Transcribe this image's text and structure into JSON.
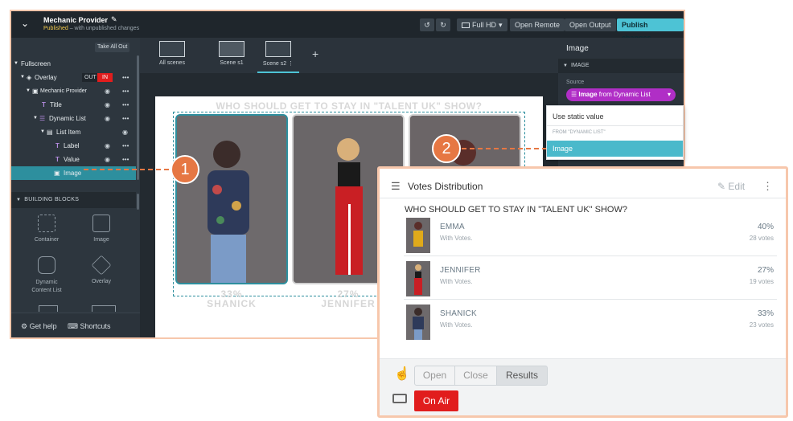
{
  "app": {
    "project_title": "Mechanic Provider",
    "status_published": "Published",
    "status_note": " – with unpublished changes",
    "toolbar": {
      "resolution": "Full HD",
      "open_remote": "Open Remote",
      "open_output": "Open Output",
      "publish": "Publish changes"
    },
    "tree": {
      "take_all_out": "Take All Out",
      "items": [
        {
          "label": "Fullscreen"
        },
        {
          "label": "Overlay",
          "out": "OUT",
          "in": "IN"
        },
        {
          "label": "Mechanic Provider"
        },
        {
          "label": "Title"
        },
        {
          "label": "Dynamic List"
        },
        {
          "label": "List Item"
        },
        {
          "label": "Label"
        },
        {
          "label": "Value"
        },
        {
          "label": "Image"
        }
      ]
    },
    "building_blocks": {
      "header": "BUILDING BLOCKS",
      "items": [
        {
          "label": "Container"
        },
        {
          "label": "Image"
        },
        {
          "label": "Dynamic Content List"
        },
        {
          "label": "Overlay"
        }
      ]
    },
    "footer": {
      "help": "Get help",
      "shortcuts": "Shortcuts"
    },
    "scenes": [
      {
        "label": "All scenes"
      },
      {
        "label": "Scene s1"
      },
      {
        "label": "Scene s2"
      }
    ],
    "canvas": {
      "title": "WHO SHOULD GET TO STAY IN \"TALENT UK\" SHOW?",
      "items": [
        {
          "pct": "33%",
          "name": "SHANICK"
        },
        {
          "pct": "27%",
          "name": "JENNIFER"
        }
      ]
    },
    "right_panel": {
      "title": "Image",
      "section": "IMAGE",
      "source_label": "Source",
      "source_value": "Image",
      "source_suffix": " from Dynamic List"
    },
    "dropdown": {
      "static": "Use static value",
      "group": "FROM \"DYNAMIC LIST\"",
      "option": "Image"
    }
  },
  "votes": {
    "title": "Votes Distribution",
    "edit": "Edit",
    "question": "WHO SHOULD GET TO STAY IN \"TALENT UK\" SHOW?",
    "rows": [
      {
        "name": "EMMA",
        "sub": "With Votes.",
        "pct": "40%",
        "votes": "28 votes"
      },
      {
        "name": "JENNIFER",
        "sub": "With Votes.",
        "pct": "27%",
        "votes": "19 votes"
      },
      {
        "name": "SHANICK",
        "sub": "With Votes.",
        "pct": "33%",
        "votes": "23 votes"
      }
    ],
    "controls": {
      "open": "Open",
      "close": "Close",
      "results": "Results",
      "on_air": "On Air"
    }
  },
  "callouts": [
    "1",
    "2"
  ],
  "colors": {
    "accent": "#4dc3d5",
    "selection": "#2d8f9e",
    "callout": "#e67743",
    "on_air": "#e11d1d",
    "source_pill": "#b02ec6"
  }
}
